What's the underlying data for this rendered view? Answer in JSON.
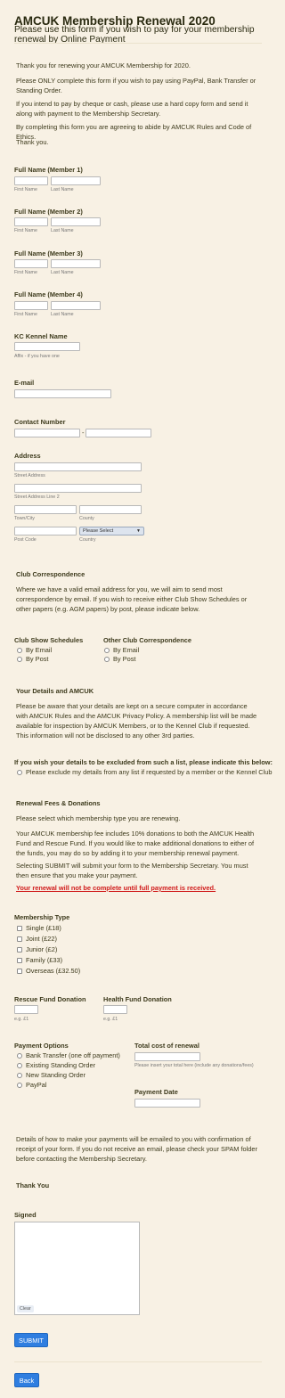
{
  "header": {
    "title": "AMCUK Membership Renewal 2020",
    "subtitle": "Please use this form if you wish to pay for your membership renewal by Online Payment"
  },
  "intro": [
    "Thank you for renewing your AMCUK Membership for 2020.",
    "Please ONLY complete this form if you wish to pay using PayPal, Bank Transfer or Standing Order.",
    "If you intend to pay by cheque or cash, please use a hard copy form and send it along with payment to the Membership Secretary.",
    "By completing this form you are agreeing to abide by AMCUK Rules and Code of Ethics.",
    "Thank you."
  ],
  "members": [
    {
      "label": "Full Name (Member 1)",
      "first": "First Name",
      "last": "Last Name"
    },
    {
      "label": "Full Name (Member 2)",
      "first": "First Name",
      "last": "Last Name"
    },
    {
      "label": "Full Name (Member 3)",
      "first": "First Name",
      "last": "Last Name"
    },
    {
      "label": "Full Name (Member 4)",
      "first": "First Name",
      "last": "Last Name"
    }
  ],
  "kennel": {
    "label": "KC Kennel Name",
    "hint": "Affix - if you have one"
  },
  "email": {
    "label": "E-mail"
  },
  "contact": {
    "label": "Contact Number",
    "separator": "-"
  },
  "address": {
    "label": "Address",
    "street": "Street Address",
    "street2": "Street Address Line 2",
    "city": "Town/City",
    "county": "County",
    "postcode": "Post Code",
    "country": "Country",
    "country_value": "Please Select"
  },
  "correspondence": {
    "heading": "Club Correspondence",
    "text": "Where we have a valid email address for you, we will aim to send most correspondence by email.  If you wish to receive either Club Show Schedules or other papers (e.g. AGM papers) by post, please indicate below."
  },
  "schedules": {
    "label": "Club Show Schedules",
    "options": [
      "By Email",
      "By Post"
    ]
  },
  "other_corr": {
    "label": "Other Club Correspondence",
    "options": [
      "By Email",
      "By Post"
    ]
  },
  "details": {
    "heading": "Your Details and AMCUK",
    "text": "Please be aware that your details are kept on a secure computer in accordance with AMCUK Rules and the AMCUK Privacy Policy.  A membership list will be made available for inspection by AMCUK Members, or to the Kennel Club if requested. This information will not be disclosed to any other 3rd parties."
  },
  "exclude": {
    "label": "If you wish your details to be excluded from such a list, please indicate this below:",
    "option": "Please exclude my details from any list if requested by a member or the Kennel Club"
  },
  "fees": {
    "heading": "Renewal Fees & Donations",
    "p1": "Please select which membership type you are renewing.",
    "p2": "Your AMCUK membership fee includes 10% donations to both the AMCUK Health Fund and Rescue Fund. If you would like to make additional donations to either of the funds, you may do so by adding it to your membership renewal payment.",
    "p3": "Selecting SUBMIT will submit your form to the Membership Secretary.  You must then ensure that you make your payment.",
    "warning": "Your renewal will not be complete until full payment is received."
  },
  "membership": {
    "label": "Membership Type",
    "options": [
      "Single (£18)",
      "Joint (£22)",
      "Junior (£2)",
      "Family (£33)",
      "Overseas (£32.50)"
    ]
  },
  "rescue": {
    "label": "Rescue Fund Donation",
    "hint": "e.g. £1"
  },
  "health": {
    "label": "Health Fund Donation",
    "hint": "e.g. £1"
  },
  "payment": {
    "label": "Payment Options",
    "options": [
      "Bank Transfer (one off payment)",
      "Existing Standing Order",
      "New Standing Order",
      "PayPal"
    ]
  },
  "total": {
    "label": "Total cost of renewal",
    "hint": "Please insert your total here (include any donations/fees)"
  },
  "pay_date": {
    "label": "Payment Date"
  },
  "closing": {
    "text": "Details of how to make your payments will be emailed to you with confirmation of receipt of your form.   If you do not receive an email, please check your SPAM folder before contacting the Membership Secretary.",
    "thanks": "Thank You"
  },
  "signed": {
    "label": "Signed",
    "clear": "Clear"
  },
  "buttons": {
    "submit": "SUBMIT",
    "back": "Back"
  }
}
